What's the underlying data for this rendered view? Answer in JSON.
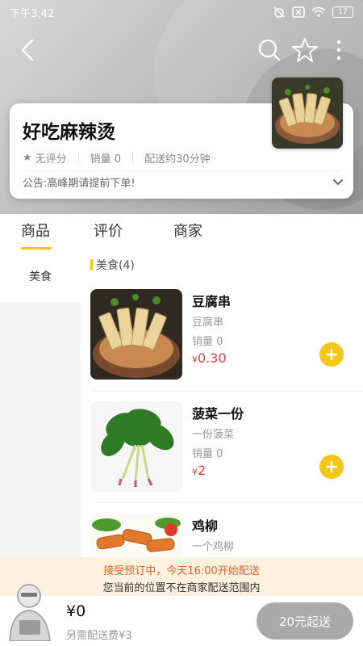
{
  "status_bar": {
    "time": "下午3:42",
    "battery": "17"
  },
  "shop": {
    "name": "好吃麻辣烫",
    "rating": "无评分",
    "sales": "销量 0",
    "delivery": "配送约30分钟",
    "notice": "公告:高峰期请提前下单!"
  },
  "tabs": [
    "商品",
    "评价",
    "商家"
  ],
  "sidebar": {
    "categories": [
      "美食"
    ]
  },
  "section": {
    "title": "美食(4)"
  },
  "products": [
    {
      "name": "豆腐串",
      "desc": "豆腐串",
      "sales": "销量 0",
      "price": "0.30",
      "currency": "¥"
    },
    {
      "name": "菠菜一份",
      "desc": "一份菠菜",
      "sales": "销量 0",
      "price": "2",
      "currency": "¥"
    },
    {
      "name": "鸡柳",
      "desc": "一个鸡柳"
    }
  ],
  "notice_bar": {
    "line1": "接受预订中，今天16:00开始配送",
    "line2": "您当前的位置不在商家配送范围内"
  },
  "cart": {
    "total": "¥0",
    "delivery_fee": "另需配送费¥3",
    "checkout_label": "20元起送"
  },
  "colors": {
    "accent": "#f5c518",
    "price": "#e24040",
    "notice_text": "#e0662a",
    "notice_bg": "#fdf0dc",
    "checkout_bg": "#a9a9a9"
  }
}
